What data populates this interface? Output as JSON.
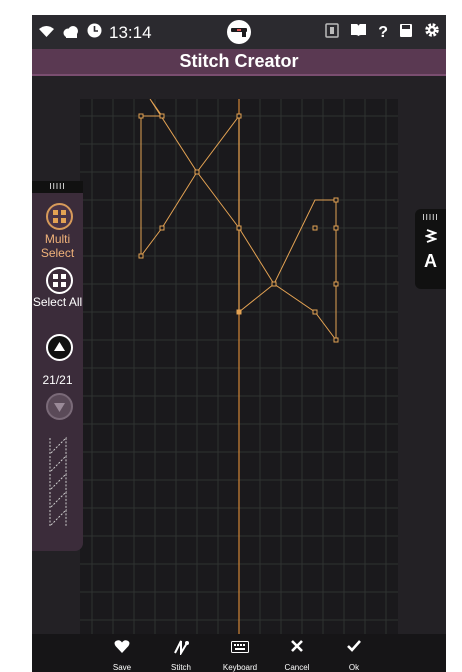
{
  "status": {
    "time": "13:14",
    "wifi_icon": "wifi-icon",
    "cloud_icon": "cloud-icon",
    "clock_icon": "clock-icon",
    "right_icons": [
      "sewing-machine-icon",
      "book-icon",
      "help-icon",
      "save-icon",
      "gear-icon"
    ]
  },
  "title": "Stitch Creator",
  "side": {
    "header": "IIIII",
    "multi_select": "Multi Select",
    "select_all": "Select All",
    "counter": "21/21"
  },
  "right": {
    "header": "IIIII",
    "letter": "A"
  },
  "bottom": {
    "save": "Save",
    "stitch": "Stitch",
    "keyboard": "Keyboard",
    "cancel": "Cancel",
    "ok": "Ok"
  },
  "colors": {
    "accent": "#e3a253",
    "title_bg": "#5a3952",
    "panel_bg": "#3b2c3a"
  }
}
